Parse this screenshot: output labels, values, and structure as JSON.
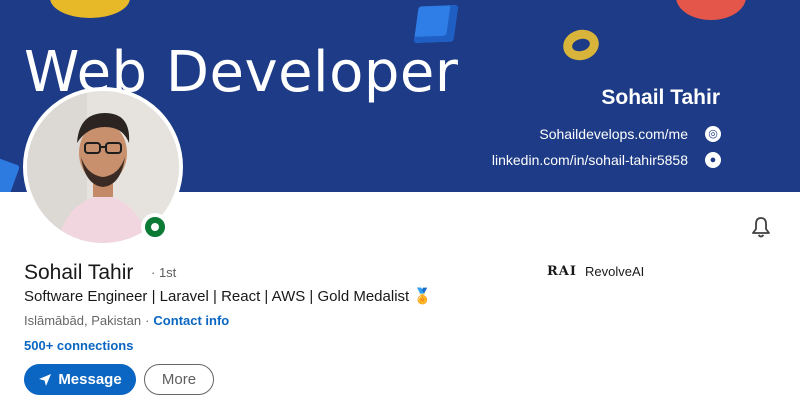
{
  "banner": {
    "title": "Web Developer",
    "name": "Sohail Tahir",
    "website": "Sohaildevelops.com/me",
    "linkedin": "linkedin.com/in/sohail-tahir5858",
    "website_icon": "globe-icon",
    "linkedin_icon": "person-icon"
  },
  "profile": {
    "name": "Sohail Tahir",
    "degree": "· 1st",
    "headline": "Software Engineer | Laravel | React | AWS | Gold Medalist 🏅",
    "location": "Islāmābād, Pakistan",
    "separator": "·",
    "contact_info": "Contact info",
    "connections": "500+ connections",
    "online_status_icon": "open-to-work-ring-icon"
  },
  "company": {
    "logo_text": "RAI",
    "name": "RevolveAI"
  },
  "actions": {
    "message_label": "Message",
    "more_label": "More",
    "notification_icon": "bell-icon"
  },
  "colors": {
    "banner_bg": "#1d3b86",
    "primary": "#0a66c2",
    "status_green": "#0a7a34"
  }
}
